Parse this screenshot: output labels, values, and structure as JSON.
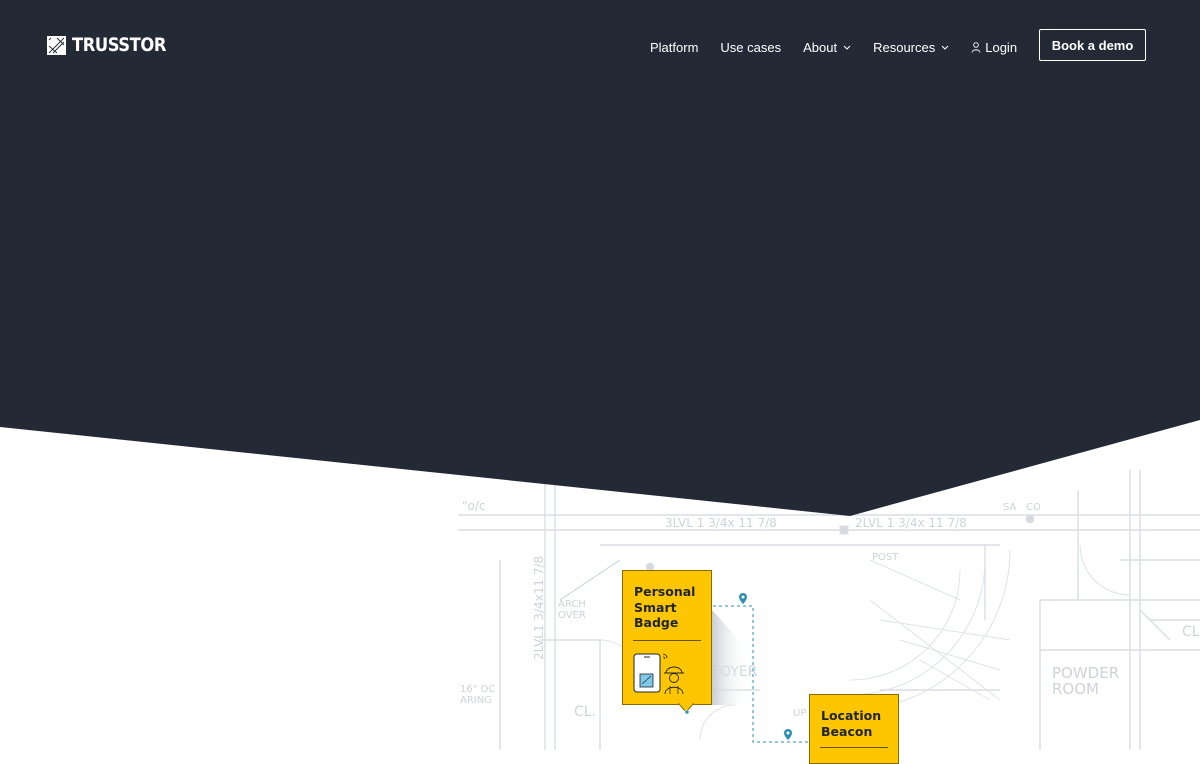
{
  "brand": {
    "name": "TRUSSTOR",
    "logo_icon": "trusstor-logo-icon"
  },
  "nav": {
    "items": [
      {
        "label": "Platform",
        "has_dropdown": false
      },
      {
        "label": "Use cases",
        "has_dropdown": false
      },
      {
        "label": "About",
        "has_dropdown": true
      },
      {
        "label": "Resources",
        "has_dropdown": true
      },
      {
        "label": "Login",
        "icon": "user-icon"
      }
    ],
    "cta_label": "Book a demo"
  },
  "illustration": {
    "badge_card": {
      "title": "Personal Smart Badge"
    },
    "beacon_card": {
      "title": "Location Beacon"
    },
    "floorplan_labels": [
      "3LVL 1 3/4x 11 7/8",
      "2LVL 1 3/4x 11 7/8",
      "POST",
      "ARCH OVER",
      "POWDER ROOM",
      "FOYER",
      "CL.",
      "SA CO",
      "UP",
      "16\" OC",
      "2LVL1 3/4x11 7/8"
    ]
  },
  "colors": {
    "hero_dark": "#232a36",
    "accent_yellow": "#fdc600",
    "pin_blue": "#2f8fb0",
    "blueprint_line": "#d6dbe1"
  }
}
